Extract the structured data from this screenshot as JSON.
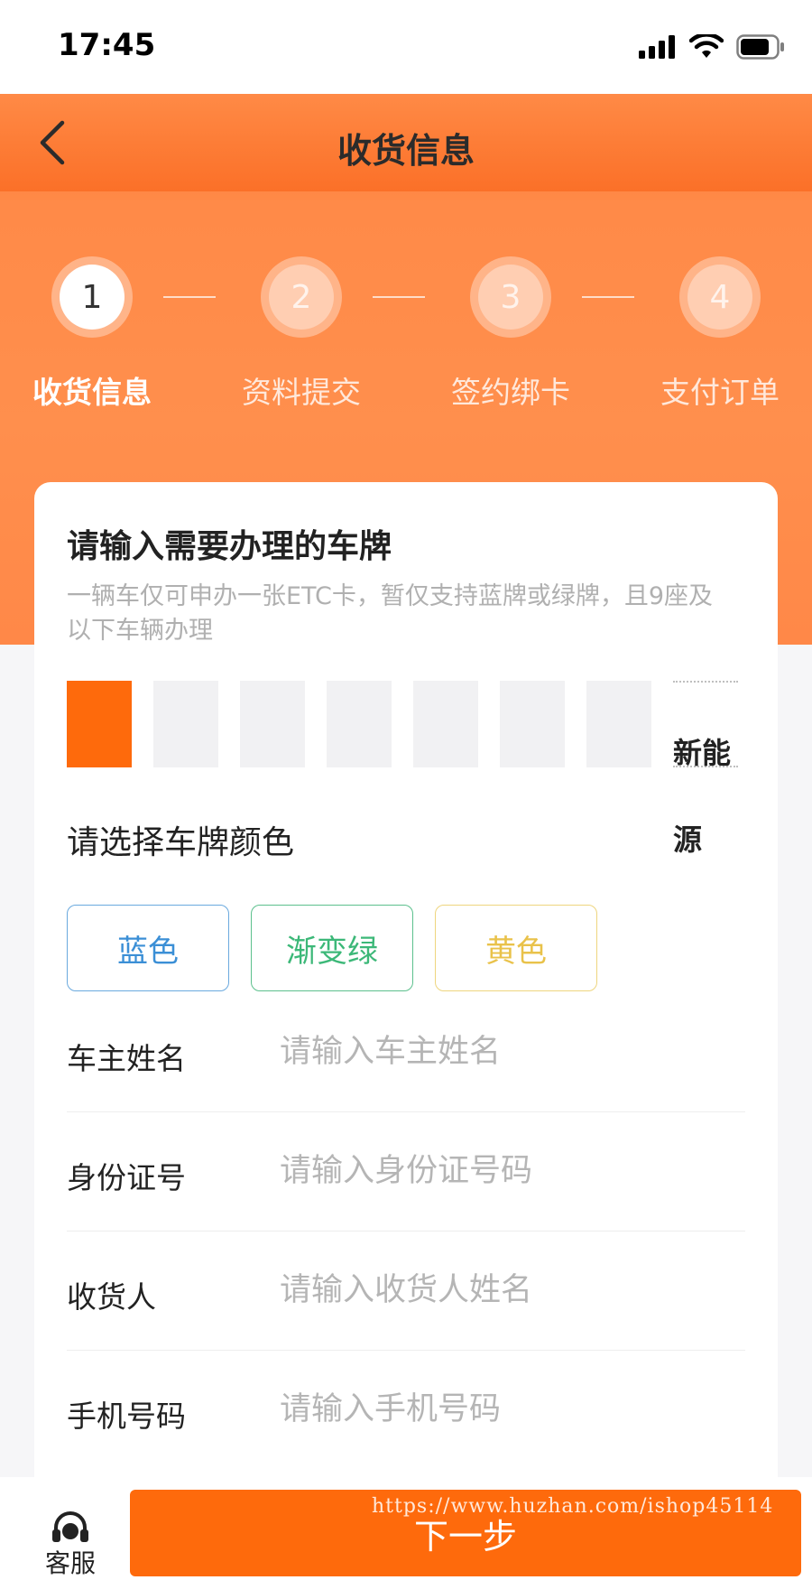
{
  "status_bar": {
    "time": "17:45"
  },
  "nav": {
    "title": "收货信息"
  },
  "steps": [
    {
      "number": "1",
      "label": "收货信息",
      "active": true
    },
    {
      "number": "2",
      "label": "资料提交",
      "active": false
    },
    {
      "number": "3",
      "label": "签约绑卡",
      "active": false
    },
    {
      "number": "4",
      "label": "支付订单",
      "active": false
    }
  ],
  "plate_section": {
    "title": "请输入需要办理的车牌",
    "description": "一辆车仅可申办一张ETC卡，暂仅支持蓝牌或绿牌，且9座及以下车辆办理",
    "new_energy_label": "新能源",
    "slots": 7,
    "active_slot": 0
  },
  "color_section": {
    "title": "请选择车牌颜色",
    "options": [
      {
        "label": "蓝色",
        "color": "#3b8fd6"
      },
      {
        "label": "渐变绿",
        "color": "#3cb878"
      },
      {
        "label": "黄色",
        "color": "#e9c24a"
      }
    ]
  },
  "form": {
    "owner_name": {
      "label": "车主姓名",
      "placeholder": "请输入车主姓名"
    },
    "id_number": {
      "label": "身份证号",
      "placeholder": "请输入身份证号码"
    },
    "receiver": {
      "label": "收货人",
      "placeholder": "请输入收货人姓名"
    },
    "phone": {
      "label": "手机号码",
      "placeholder": "请输入手机号码"
    }
  },
  "bottom": {
    "service_label": "客服",
    "next_label": "下一步",
    "watermark": "https://www.huzhan.com/ishop45114"
  },
  "colors": {
    "accent": "#fe6a0c",
    "header": "#fb7028"
  }
}
